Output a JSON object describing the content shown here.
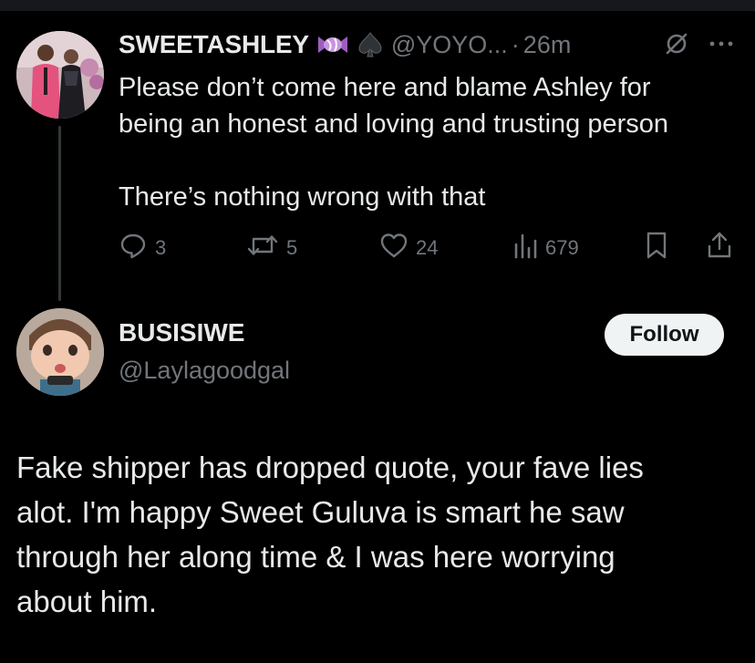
{
  "tweet1": {
    "display_name": "SWEETASHLEY",
    "emojis": [
      "candy-emoji",
      "spade-emoji"
    ],
    "handle": "@YOYO...",
    "separator": "·",
    "time": "26m",
    "text_lines": [
      "Please don’t come here and blame Ashley for",
      "being an honest and loving and trusting person",
      "There’s nothing wrong with that"
    ],
    "stats": {
      "replies": "3",
      "reposts": "5",
      "likes": "24",
      "views": "679"
    },
    "icons": [
      "mute-icon",
      "more-icon",
      "reply-icon",
      "repost-icon",
      "like-icon",
      "views-icon",
      "bookmark-icon",
      "share-icon"
    ]
  },
  "tweet2": {
    "display_name": "BUSISIWE",
    "handle": "@Laylagoodgal",
    "follow_label": "Follow",
    "text_lines": [
      "Fake shipper has dropped quote, your fave lies",
      "alot. I'm happy Sweet Guluva is smart he saw",
      "through her along time & I was here worrying",
      "about him."
    ]
  },
  "colors": {
    "background": "#000000",
    "primary_text": "#e7e9ea",
    "secondary_text": "#71767b",
    "follow_button_bg": "#eff3f4",
    "follow_button_text": "#0f1419",
    "thread_line": "#333639"
  }
}
